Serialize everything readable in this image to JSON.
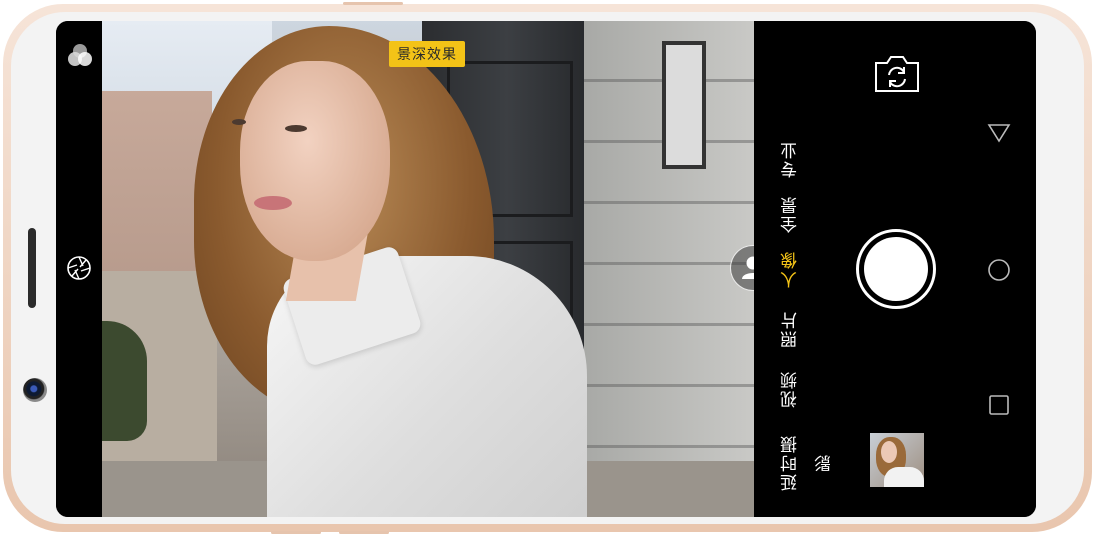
{
  "viewfinder": {
    "effect_label": "景深效果"
  },
  "modes": [
    {
      "label": "专业",
      "active": false
    },
    {
      "label": "全景",
      "active": false
    },
    {
      "label": "人像",
      "active": true
    },
    {
      "label": "照片",
      "active": false
    },
    {
      "label": "视频",
      "active": false
    },
    {
      "label": "延时摄影",
      "active": false
    }
  ],
  "colors": {
    "accent": "#f3c317",
    "frame": "#e9c6ae",
    "screen_bg": "#000000"
  },
  "icons": {
    "left_top": "filter-icon",
    "left_middle": "aperture-icon",
    "overlay": "person-portrait-icon",
    "top_right": "switch-camera-icon",
    "nav": [
      "back-icon",
      "home-icon",
      "recents-icon"
    ]
  }
}
